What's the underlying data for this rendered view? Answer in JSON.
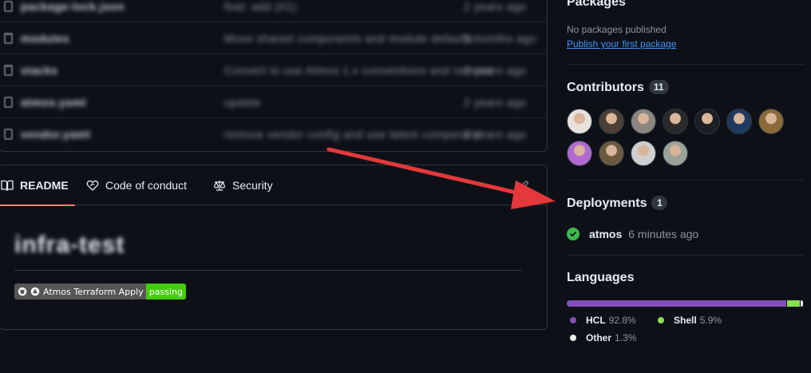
{
  "files": [
    {
      "type": "file",
      "name": "package-lock.json",
      "message": "feat: add (#1)",
      "time": "2 years ago"
    },
    {
      "type": "folder",
      "name": "modules",
      "message": "Move shared components and module defaults",
      "time": "3 months ago"
    },
    {
      "type": "folder",
      "name": "stacks",
      "message": "Convert to use Atmos 1.x conventions and remove",
      "time": "2 years ago"
    },
    {
      "type": "file",
      "name": "atmos.yaml",
      "message": "update",
      "time": "2 years ago"
    },
    {
      "type": "file",
      "name": "vendor.yaml",
      "message": "remove vendor config and use latest component",
      "time": "2 years ago"
    }
  ],
  "readme": {
    "tabs": [
      {
        "label": "README",
        "icon": "book-icon",
        "active": true
      },
      {
        "label": "Code of conduct",
        "icon": "heart-icon",
        "active": false
      },
      {
        "label": "Security",
        "icon": "law-icon",
        "active": false
      }
    ],
    "title": "infra-test",
    "badge": {
      "label": "Atmos Terraform Apply",
      "status": "passing",
      "status_color": "#44cc11"
    }
  },
  "sidebar": {
    "packages": {
      "heading": "Packages",
      "empty_text": "No packages published",
      "link_text": "Publish your first package"
    },
    "contributors": {
      "heading": "Contributors",
      "count": "11",
      "avatars": [
        {
          "label": "contributor-1",
          "color": "#e8e2dc"
        },
        {
          "label": "contributor-2",
          "color": "#4a4038"
        },
        {
          "label": "contributor-3",
          "color": "#8a8680"
        },
        {
          "label": "contributor-4",
          "color": "#2a2a2a"
        },
        {
          "label": "contributor-5",
          "color": "#1b1f23"
        },
        {
          "label": "contributor-6",
          "color": "#1e3a5f"
        },
        {
          "label": "contributor-7",
          "color": "#8b6a3a"
        },
        {
          "label": "contributor-8",
          "color": "#b06ad0"
        },
        {
          "label": "contributor-9",
          "color": "#6b5a40"
        },
        {
          "label": "contributor-10",
          "color": "#cfcfcf"
        },
        {
          "label": "contributor-11",
          "color": "#9aa39a"
        }
      ]
    },
    "deployments": {
      "heading": "Deployments",
      "count": "1",
      "name": "atmos",
      "time": "6 minutes ago"
    },
    "languages": {
      "heading": "Languages",
      "items": [
        {
          "name": "HCL",
          "percent": "92.8%",
          "value": 92.8,
          "color": "#844fba"
        },
        {
          "name": "Shell",
          "percent": "5.9%",
          "value": 5.9,
          "color": "#89e051"
        },
        {
          "name": "Other",
          "percent": "1.3%",
          "value": 1.3,
          "color": "#ededed"
        }
      ]
    }
  },
  "colors": {
    "accent_tab": "#f78166",
    "annotation_arrow": "#e5383b"
  }
}
